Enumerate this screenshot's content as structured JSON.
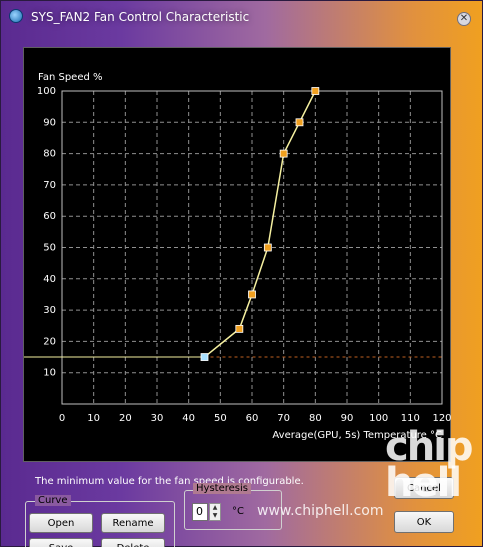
{
  "window": {
    "title": "SYS_FAN2 Fan Control Characteristic",
    "close_glyph": "✕"
  },
  "chart_data": {
    "type": "line",
    "ylabel": "Fan Speed %",
    "xlabel": "Average(GPU, 5s) Temperature °C",
    "xlim": [
      0,
      120
    ],
    "ylim": [
      0,
      100
    ],
    "xticks": [
      0,
      10,
      20,
      30,
      40,
      50,
      60,
      70,
      80,
      90,
      100,
      110,
      120
    ],
    "yticks": [
      10,
      20,
      30,
      40,
      50,
      60,
      70,
      80,
      90,
      100
    ],
    "grid": true,
    "minimum_speed": 15,
    "points": [
      {
        "x": 45,
        "y": 15
      },
      {
        "x": 56,
        "y": 24
      },
      {
        "x": 60,
        "y": 35
      },
      {
        "x": 65,
        "y": 50
      },
      {
        "x": 70,
        "y": 80
      },
      {
        "x": 75,
        "y": 90
      },
      {
        "x": 80,
        "y": 100
      }
    ],
    "colors": {
      "curve": "#f5f0a0",
      "point": "#f0a020",
      "first_point": "#a8e0ff",
      "grid": "#909090",
      "axis_text": "#ffffff",
      "min_line": "#f5f0a0",
      "min_line_dashed": "#c06020"
    }
  },
  "info_text": "The minimum value for the fan speed is configurable.",
  "curve_group": {
    "label": "Curve",
    "open": "Open",
    "rename": "Rename",
    "save": "Save",
    "delete": "Delete"
  },
  "hysteresis": {
    "label": "Hysteresis",
    "value": "0",
    "unit": "°C"
  },
  "buttons": {
    "cancel": "Cancel",
    "ok": "OK"
  },
  "watermark": {
    "logo_text": "chip hell",
    "url": "www.chiphell.com"
  }
}
